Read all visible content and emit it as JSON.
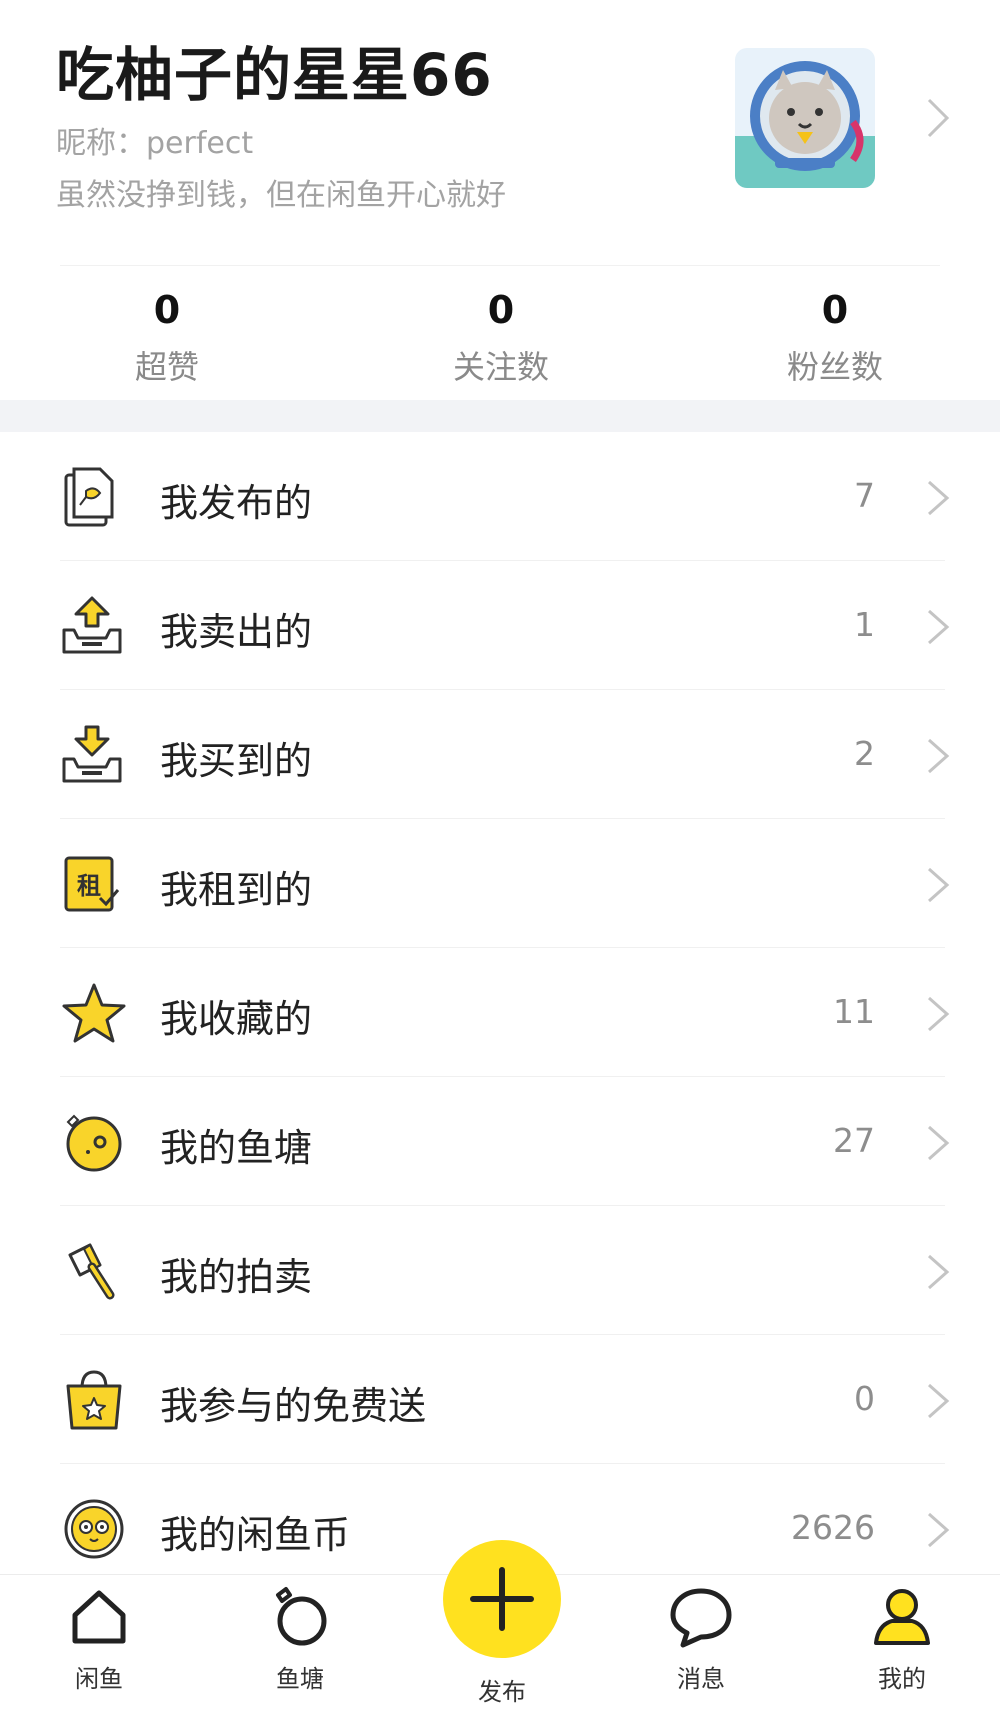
{
  "profile": {
    "username": "吃柚子的星星66",
    "nickname": "昵称：perfect",
    "bio": "虽然没挣到钱，但在闲鱼开心就好"
  },
  "stats": [
    {
      "value": "0",
      "label": "超赞"
    },
    {
      "value": "0",
      "label": "关注数"
    },
    {
      "value": "0",
      "label": "粉丝数"
    }
  ],
  "menu": [
    {
      "label": "我发布的",
      "count": "7",
      "icon": "document-icon"
    },
    {
      "label": "我卖出的",
      "count": "1",
      "icon": "outbox-icon"
    },
    {
      "label": "我买到的",
      "count": "2",
      "icon": "inbox-icon"
    },
    {
      "label": "我租到的",
      "count": "",
      "icon": "rent-icon",
      "icon_text": "租"
    },
    {
      "label": "我收藏的",
      "count": "11",
      "icon": "star-icon"
    },
    {
      "label": "我的鱼塘",
      "count": "27",
      "icon": "fishpond-icon"
    },
    {
      "label": "我的拍卖",
      "count": "",
      "icon": "gavel-icon"
    },
    {
      "label": "我参与的免费送",
      "count": "0",
      "icon": "gift-bag-icon"
    },
    {
      "label": "我的闲鱼币",
      "count": "2626",
      "icon": "coin-icon"
    }
  ],
  "tabs": [
    {
      "label": "闲鱼",
      "icon": "home-icon"
    },
    {
      "label": "鱼塘",
      "icon": "fishpond-tab-icon"
    },
    {
      "label": "发布",
      "icon": "plus-icon"
    },
    {
      "label": "消息",
      "icon": "message-icon"
    },
    {
      "label": "我的",
      "icon": "person-icon"
    }
  ],
  "colors": {
    "accent": "#ffe11f",
    "icon_fill": "#f9d42a",
    "icon_stroke": "#333333"
  }
}
